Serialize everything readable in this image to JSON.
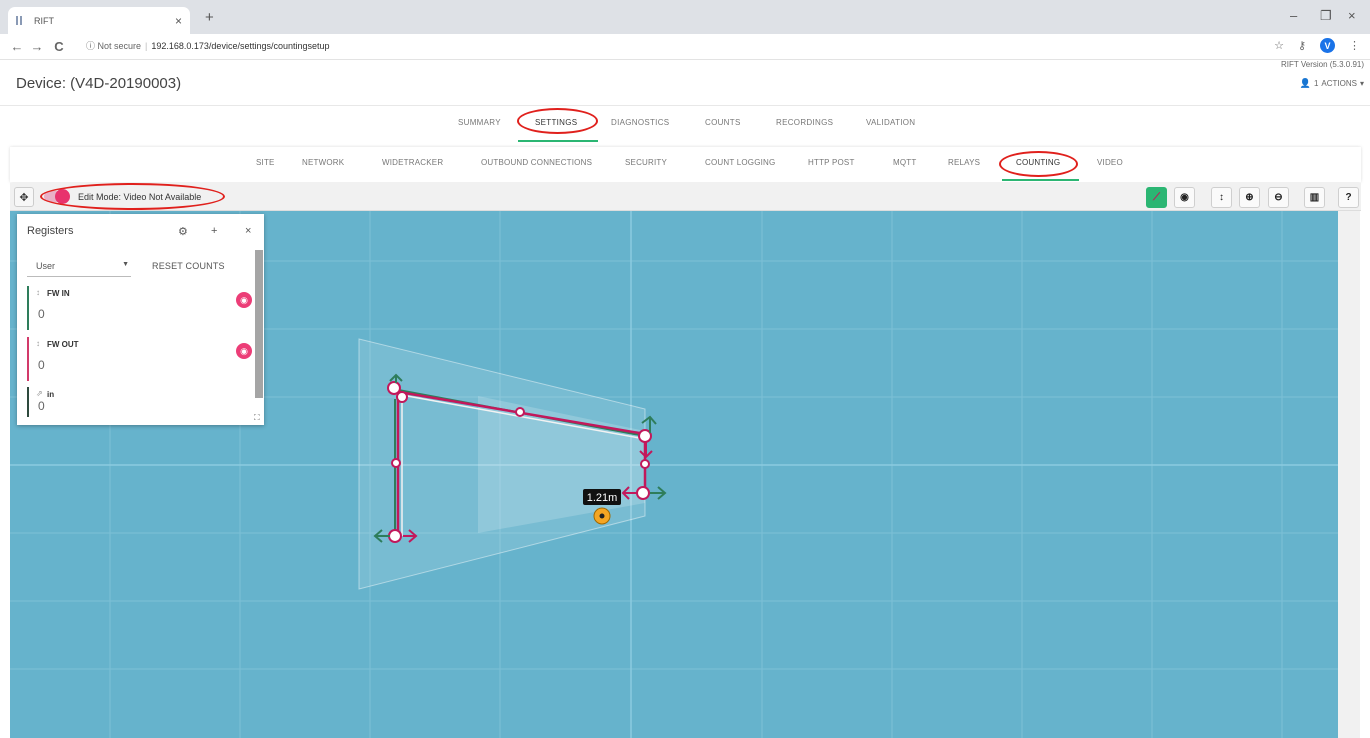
{
  "browser": {
    "tab_title": "RIFT",
    "tab_close": "×",
    "new_tab": "+",
    "minimize": "–",
    "restore": "❐",
    "close": "×",
    "back": "←",
    "forward": "→",
    "reload": "C",
    "security": "ⓘ Not secure",
    "url": "192.168.0.173/device/settings/countingsetup",
    "star": "☆",
    "key": "⚷",
    "profile": "V",
    "menu": "⋮"
  },
  "header": {
    "device_title": "Device: (V4D-20190003)",
    "version": "RIFT Version (5.3.0.91)",
    "user_count": "1",
    "actions_label": "ACTIONS"
  },
  "main_nav": [
    "SUMMARY",
    "SETTINGS",
    "DIAGNOSTICS",
    "COUNTS",
    "RECORDINGS",
    "VALIDATION"
  ],
  "main_nav_active": "SETTINGS",
  "sub_nav": [
    "SITE",
    "NETWORK",
    "WIDETRACKER",
    "OUTBOUND CONNECTIONS",
    "SECURITY",
    "COUNT LOGGING",
    "HTTP POST",
    "MQTT",
    "RELAYS",
    "COUNTING",
    "VIDEO"
  ],
  "sub_nav_active": "COUNTING",
  "toolbar": {
    "move_icon": "✥",
    "edit_mode_label": "Edit Mode: Video Not Available",
    "edit_mode_on": true,
    "tools": [
      {
        "name": "draw-line-icon",
        "glyph": "⟋",
        "active": true
      },
      {
        "name": "eye-icon",
        "glyph": "◉",
        "active": false
      },
      {
        "name": "height-icon",
        "glyph": "↕",
        "active": false
      },
      {
        "name": "zoom-in-icon",
        "glyph": "⊕",
        "active": false
      },
      {
        "name": "zoom-out-icon",
        "glyph": "⊖",
        "active": false
      },
      {
        "name": "map-icon",
        "glyph": "▥",
        "active": false
      },
      {
        "name": "help-icon",
        "glyph": "?",
        "active": false
      }
    ]
  },
  "registers": {
    "title": "Registers",
    "gear": "⚙",
    "plus": "+",
    "close": "×",
    "filter_value": "User",
    "reset_label": "RESET COUNTS",
    "expand": "⛶",
    "items": [
      {
        "name": "FW IN",
        "count": "0",
        "type_icon": "↕",
        "color": "#2e7d5b",
        "has_eye": true
      },
      {
        "name": "FW OUT",
        "count": "0",
        "type_icon": "↕",
        "color": "#d23a6a",
        "has_eye": true
      },
      {
        "name": "in",
        "count": "0",
        "type_icon": "⇗",
        "color": "#2e4a3d",
        "has_eye": false
      }
    ]
  },
  "canvas": {
    "measurement": "1.21m",
    "background_color": "#66b3cc"
  }
}
